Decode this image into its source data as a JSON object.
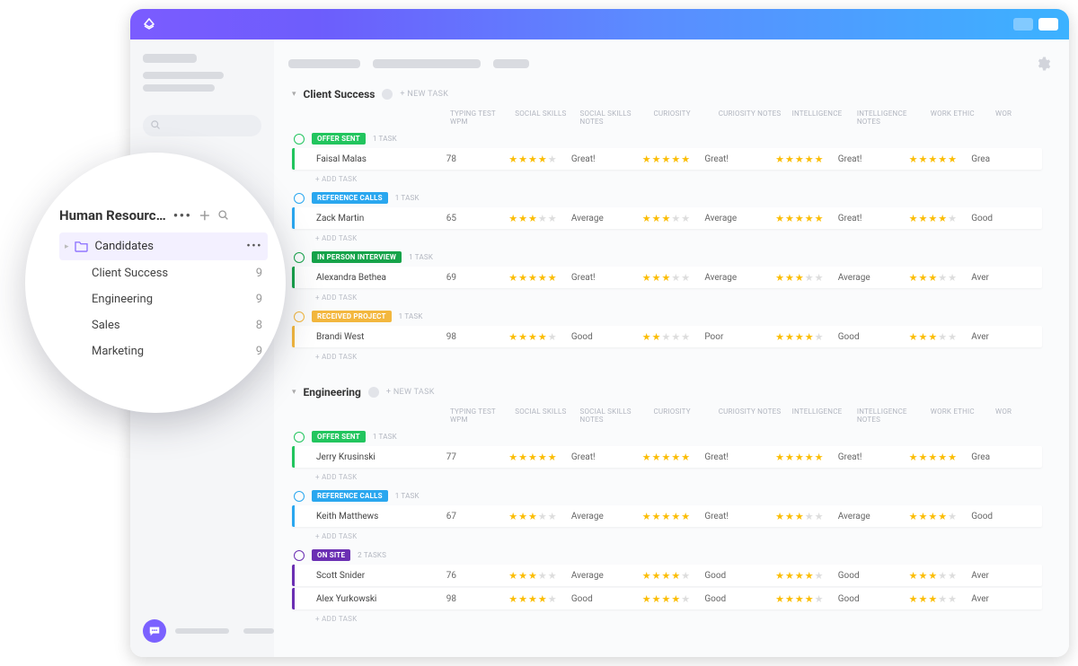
{
  "titlebar": {
    "logo_glyph": "◆"
  },
  "popover": {
    "title": "Human Resourc…",
    "active_item": {
      "label": "Candidates"
    },
    "sub_items": [
      {
        "label": "Client Success",
        "count": 9
      },
      {
        "label": "Engineering",
        "count": 9
      },
      {
        "label": "Sales",
        "count": 8
      },
      {
        "label": "Marketing",
        "count": 9
      }
    ]
  },
  "columns": {
    "wpm": "TYPING TEST WPM",
    "social": "SOCIAL SKILLS",
    "social_notes": "SOCIAL SKILLS NOTES",
    "curiosity": "CURIOSITY",
    "curiosity_notes": "CURIOSITY NOTES",
    "intelligence": "INTELLIGENCE",
    "intelligence_notes": "INTELLIGENCE NOTES",
    "work_ethic": "WORK ETHIC",
    "work": "WOR"
  },
  "labels": {
    "new_task": "+ NEW TASK",
    "add_task": "+ ADD TASK",
    "one_task": "1 TASK",
    "two_tasks": "2 TASKS"
  },
  "sections": [
    {
      "title": "Client Success",
      "groups": [
        {
          "status": "OFFER SENT",
          "color": "#22c55e",
          "count_label": "1 TASK",
          "tasks": [
            {
              "name": "Faisal Malas",
              "wpm": 78,
              "social": 4,
              "social_note": "Great!",
              "curiosity": 5,
              "curiosity_note": "Great!",
              "intelligence": 5,
              "intelligence_note": "Great!",
              "work_ethic": 5,
              "work_note": "Grea"
            }
          ]
        },
        {
          "status": "REFERENCE CALLS",
          "color": "#2aa7ef",
          "count_label": "1 TASK",
          "tasks": [
            {
              "name": "Zack Martin",
              "wpm": 65,
              "social": 3,
              "social_note": "Average",
              "curiosity": 3,
              "curiosity_note": "Average",
              "intelligence": 5,
              "intelligence_note": "Great!",
              "work_ethic": 4,
              "work_note": "Good"
            }
          ]
        },
        {
          "status": "IN PERSON INTERVIEW",
          "color": "#16a34a",
          "count_label": "1 TASK",
          "tasks": [
            {
              "name": "Alexandra Bethea",
              "wpm": 69,
              "social": 5,
              "social_note": "Great!",
              "curiosity": 3,
              "curiosity_note": "Average",
              "intelligence": 3,
              "intelligence_note": "Average",
              "work_ethic": 3,
              "work_note": "Aver"
            }
          ]
        },
        {
          "status": "RECEIVED PROJECT",
          "color": "#f3b73e",
          "count_label": "1 TASK",
          "tasks": [
            {
              "name": "Brandi West",
              "wpm": 98,
              "social": 4,
              "social_note": "Good",
              "curiosity": 2,
              "curiosity_note": "Poor",
              "intelligence": 4,
              "intelligence_note": "Good",
              "work_ethic": 3,
              "work_note": "Aver"
            }
          ]
        }
      ]
    },
    {
      "title": "Engineering",
      "groups": [
        {
          "status": "OFFER SENT",
          "color": "#22c55e",
          "count_label": "1 TASK",
          "tasks": [
            {
              "name": "Jerry Krusinski",
              "wpm": 77,
              "social": 5,
              "social_note": "Great!",
              "curiosity": 5,
              "curiosity_note": "Great!",
              "intelligence": 5,
              "intelligence_note": "Great!",
              "work_ethic": 5,
              "work_note": "Grea"
            }
          ]
        },
        {
          "status": "REFERENCE CALLS",
          "color": "#2aa7ef",
          "count_label": "1 TASK",
          "tasks": [
            {
              "name": "Keith Matthews",
              "wpm": 67,
              "social": 3,
              "social_note": "Average",
              "curiosity": 5,
              "curiosity_note": "Great!",
              "intelligence": 3,
              "intelligence_note": "Average",
              "work_ethic": 4,
              "work_note": "Good"
            }
          ]
        },
        {
          "status": "ON SITE",
          "color": "#6b2fb3",
          "count_label": "2 TASKS",
          "tasks": [
            {
              "name": "Scott Snider",
              "wpm": 76,
              "social": 3,
              "social_note": "Average",
              "curiosity": 4,
              "curiosity_note": "Good",
              "intelligence": 4,
              "intelligence_note": "Good",
              "work_ethic": 3,
              "work_note": "Aver"
            },
            {
              "name": "Alex Yurkowski",
              "wpm": 98,
              "social": 4,
              "social_note": "Good",
              "curiosity": 4,
              "curiosity_note": "Good",
              "intelligence": 4,
              "intelligence_note": "Good",
              "work_ethic": 3,
              "work_note": "Aver"
            }
          ]
        }
      ]
    }
  ]
}
